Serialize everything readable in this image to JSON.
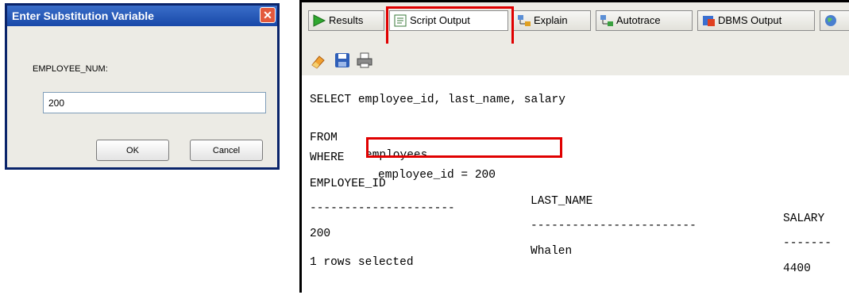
{
  "dialog": {
    "title": "Enter Substitution Variable",
    "close_symbol": "✕",
    "variable_label": "EMPLOYEE_NUM:",
    "input_value": "200",
    "ok_label": "OK",
    "cancel_label": "Cancel"
  },
  "panel": {
    "tabs": [
      {
        "label": "Results",
        "icon": "play-icon"
      },
      {
        "label": "Script Output",
        "icon": "script-output-icon",
        "active": true
      },
      {
        "label": "Explain",
        "icon": "explain-plan-icon"
      },
      {
        "label": "Autotrace",
        "icon": "autotrace-icon"
      },
      {
        "label": "DBMS Output",
        "icon": "dbms-output-icon"
      }
    ],
    "toolbar": [
      "eraser-icon",
      "save-icon",
      "print-icon"
    ],
    "output": {
      "sql_line1": "SELECT employee_id, last_name, salary",
      "sql_from_kw": "FROM",
      "sql_from_tbl": "employees",
      "sql_where_kw": "WHERE",
      "sql_where_cond": "employee_id = 200",
      "headers": [
        "EMPLOYEE_ID",
        "LAST_NAME",
        "SALARY"
      ],
      "separators": [
        "---------------------",
        "------------------------",
        "-------"
      ],
      "row": [
        "200",
        "Whalen",
        "4400"
      ],
      "footer": "1 rows selected"
    }
  },
  "colors": {
    "highlight": "#e00000",
    "title_bar": "#2456b8"
  }
}
